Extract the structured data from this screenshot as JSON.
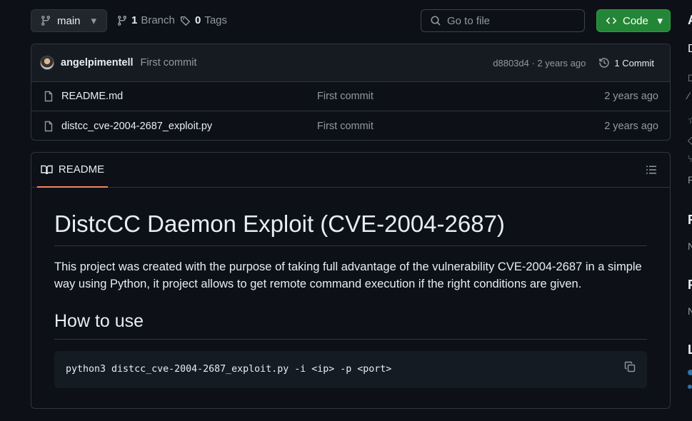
{
  "toolbar": {
    "branch": "main",
    "branch_count": "1",
    "branch_label": "Branch",
    "tag_count": "0",
    "tag_label": "Tags",
    "goto_placeholder": "Go to file",
    "code_label": "Code"
  },
  "latest_commit": {
    "author": "angelpimentell",
    "message": "First commit",
    "hash_and_age": "d8803d4 · 2 years ago",
    "commit_count": "1 Commit"
  },
  "files": [
    {
      "name": "README.md",
      "commit": "First commit",
      "age": "2 years ago"
    },
    {
      "name": "distcc_cve-2004-2687_exploit.py",
      "commit": "First commit",
      "age": "2 years ago"
    }
  ],
  "readme": {
    "tab_label": "README",
    "title": "DistcCC Daemon Exploit (CVE-2004-2687)",
    "paragraph": "This project was created with the purpose of taking full advantage of the vulnerability CVE-2004-2687 in a simple way using Python, it project allows to get remote command execution if the right conditions are given.",
    "section_heading": "How to use",
    "code": "python3 distcc_cve-2004-2687_exploit.py -i <ip> -p <port>"
  },
  "sidebar_fragments": {
    "a": "A",
    "d": "D",
    "r1": "R",
    "r2": "R",
    "p": "P",
    "n1": "N",
    "n2": "N",
    "l": "L"
  },
  "colors": {
    "background": "#0d1117",
    "border": "#30363d",
    "code_button": "#238636",
    "tab_underline": "#f78166",
    "language_python": "#3572A5"
  }
}
